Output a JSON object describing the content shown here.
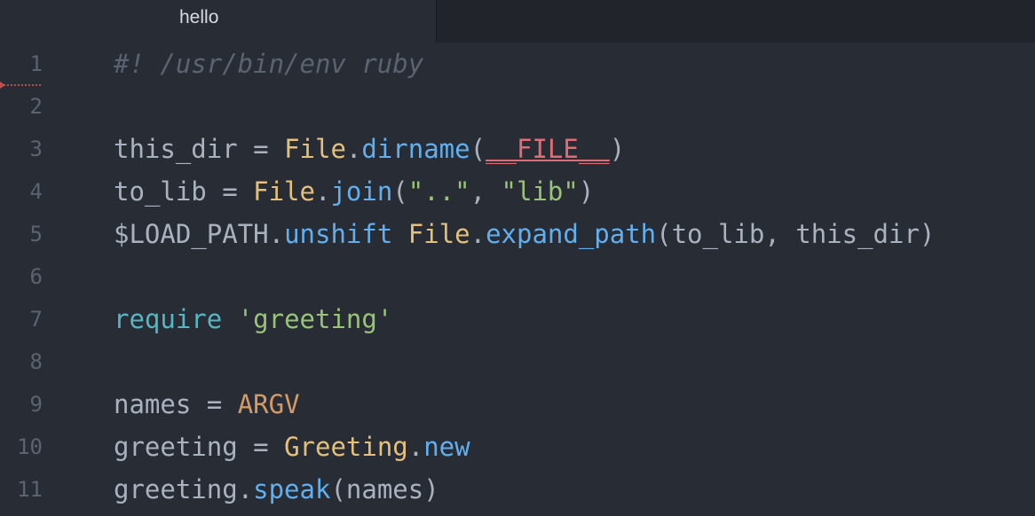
{
  "tab": {
    "title": "hello"
  },
  "colors": {
    "background": "#282c34",
    "comment": "#5c6370",
    "default_text": "#abb2bf",
    "class": "#e5c07b",
    "method": "#61afef",
    "string": "#98c379",
    "keyword": "#56b6c2",
    "magic": "#e06c75",
    "constant": "#d19a66"
  },
  "line_numbers": [
    "1",
    "2",
    "3",
    "4",
    "5",
    "6",
    "7",
    "8",
    "9",
    "10",
    "11"
  ],
  "lines": [
    {
      "t1": "#! /usr/bin/env ruby"
    },
    {},
    {
      "t1": "this_dir = ",
      "t2": "File",
      "t3": ".",
      "t4": "dirname",
      "t5": "(",
      "t6": "__FILE__",
      "t7": ")"
    },
    {
      "t1": "to_lib = ",
      "t2": "File",
      "t3": ".",
      "t4": "join",
      "t5": "(",
      "t6": "\"..\"",
      "t7": ", ",
      "t8": "\"lib\"",
      "t9": ")"
    },
    {
      "t1": "$LOAD_PATH.",
      "t2": "unshift",
      "t3": " ",
      "t4": "File",
      "t5": ".",
      "t6": "expand_path",
      "t7": "(to_lib, this_dir)"
    },
    {},
    {
      "t1": "require",
      "t2": " ",
      "t3": "'greeting'"
    },
    {},
    {
      "t1": "names = ",
      "t2": "ARGV"
    },
    {
      "t1": "greeting = ",
      "t2": "Greeting",
      "t3": ".",
      "t4": "new"
    },
    {
      "t1": "greeting.",
      "t2": "speak",
      "t3": "(names)"
    }
  ]
}
